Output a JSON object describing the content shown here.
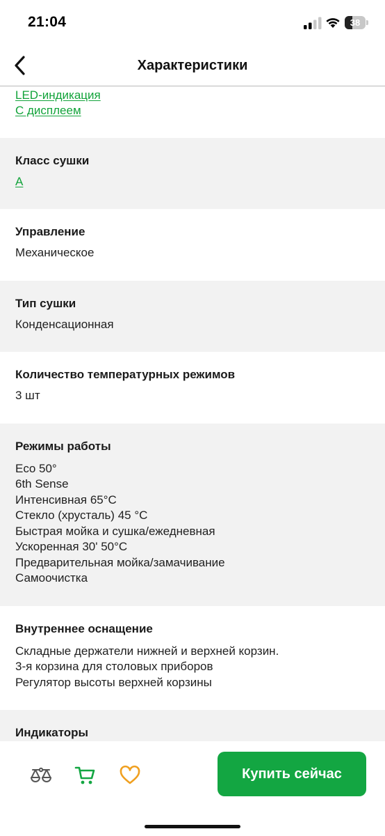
{
  "status_bar": {
    "time": "21:04",
    "battery_level": "38",
    "battery_fraction": 0.38
  },
  "header": {
    "title": "Характеристики"
  },
  "top_links": [
    "LED-индикация",
    "С дисплеем"
  ],
  "sections": [
    {
      "title": "Класс сушки",
      "link": "A"
    },
    {
      "title": "Управление",
      "values": [
        "Механическое"
      ]
    },
    {
      "title": "Тип сушки",
      "values": [
        "Конденсационная"
      ]
    },
    {
      "title": "Количество температурных режимов",
      "values": [
        "3 шт"
      ]
    },
    {
      "title": "Режимы работы",
      "values": [
        "Eco 50°",
        "6th Sense",
        "Интенсивная 65°C",
        "Стекло (хрусталь) 45 °C",
        "Быстрая мойка и сушка/ежедневная",
        "Ускоренная 30' 50°C",
        "Предварительная мойка/замачивание",
        "Самоочистка"
      ]
    },
    {
      "title": "Внутреннее оснащение",
      "values": [
        "Складные держатели нижней и верхней корзин.",
        "3-я корзина для столовых приборов",
        "Регулятор высоты верхней корзины"
      ]
    },
    {
      "title": "Индикаторы",
      "values": []
    }
  ],
  "bottom_bar": {
    "buy_label": "Купить сейчас"
  },
  "colors": {
    "accent": "#13a642",
    "link": "#12a33a",
    "favorite": "#f0a020",
    "section_gray": "#f2f2f2"
  },
  "icons": [
    "back-chevron-icon",
    "signal-icon",
    "wifi-icon",
    "battery-icon",
    "compare-scales-icon",
    "cart-icon",
    "heart-icon"
  ]
}
